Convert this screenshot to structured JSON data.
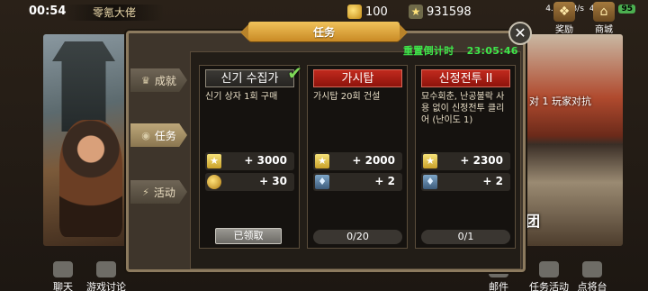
{
  "status_bar": {
    "time": "00:54",
    "net_speed": "4.50 KB/s",
    "signal": "4G",
    "battery": "95"
  },
  "player": {
    "name": "零氪大佬"
  },
  "resources": {
    "gold": "100",
    "stars": "931598"
  },
  "top_right_buttons": [
    {
      "label": "奖励",
      "icon": "gift-icon"
    },
    {
      "label": "商城",
      "icon": "shop-icon"
    }
  ],
  "bg_right": {
    "pvp_text": "对 1 玩家对抗",
    "bottom_text": "团"
  },
  "bottom_left": [
    {
      "label": "聊天",
      "icon": "chat-icon"
    },
    {
      "label": "游戏讨论",
      "icon": "people-icon"
    }
  ],
  "bottom_right": [
    {
      "label": "邮件",
      "icon": "mail-icon"
    },
    {
      "label": "任务活动",
      "icon": "quest-icon"
    },
    {
      "label": "点将台",
      "icon": "general-icon"
    }
  ],
  "panel": {
    "title": "任务",
    "countdown_label": "重置倒计时",
    "countdown_value": "23:05:46",
    "tabs": [
      {
        "label": "成就",
        "icon": "crown-icon",
        "active": false
      },
      {
        "label": "任务",
        "icon": "eye-icon",
        "active": true
      },
      {
        "label": "活动",
        "icon": "lightning-icon",
        "active": false
      }
    ],
    "quests": [
      {
        "title": "신기 수집가",
        "desc": "신기 상자 1회 구매",
        "rewards": [
          {
            "icon": "star-icon",
            "value": "+ 3000"
          },
          {
            "icon": "coin-icon",
            "value": "+ 30"
          }
        ],
        "completed": true,
        "claim_label": "已领取"
      },
      {
        "title": "가시탑",
        "desc": "가시탑 20회 건설",
        "rewards": [
          {
            "icon": "star-icon",
            "value": "+ 2000"
          },
          {
            "icon": "gem-icon",
            "value": "+ 2"
          }
        ],
        "completed": false,
        "progress_text": "0/20",
        "progress_fraction": 0
      },
      {
        "title": "신정전투 II",
        "desc": "묘수회춘, 난공불락 사용 없이 신정전투 클리어 (난이도 1)",
        "rewards": [
          {
            "icon": "star-icon",
            "value": "+ 2300"
          },
          {
            "icon": "gem-icon",
            "value": "+ 2"
          }
        ],
        "completed": false,
        "progress_text": "0/1",
        "progress_fraction": 0
      }
    ]
  }
}
